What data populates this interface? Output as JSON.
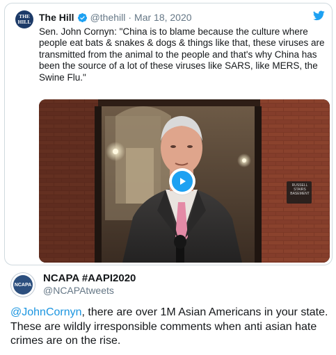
{
  "quoted_tweet": {
    "avatar_text": [
      "THE",
      "HILL"
    ],
    "name": "The Hill",
    "handle": "@thehill",
    "separator": "·",
    "date": "Mar 18, 2020",
    "text": "Sen. John Cornyn: \"China is to blame because the culture where people eat bats & snakes & dogs & things like that, these viruses are transmitted from the animal to the people and that's why China has been the source of a lot of these viruses like SARS, like MERS, the Swine Flu.\"",
    "video": {
      "sign_lines": [
        "RUSSELL",
        "STAIRS",
        "BASEMENT"
      ]
    }
  },
  "main_tweet": {
    "avatar_text": "NCAPA",
    "name": "NCAPA #AAPI2020",
    "handle": "@NCAPAtweets",
    "mention": "@JohnCornyn",
    "text": ", there are over 1M Asian Americans in your state. These are wildly irresponsible comments when anti asian hate crimes are on the rise."
  },
  "icons": {
    "verified": "verified-badge-icon",
    "platform": "twitter-bird-icon",
    "play": "play-icon"
  },
  "colors": {
    "accent": "#1da1f2",
    "link": "#1b95e0",
    "muted": "#657786",
    "text": "#14171a",
    "brick": "#8a3f2b"
  }
}
